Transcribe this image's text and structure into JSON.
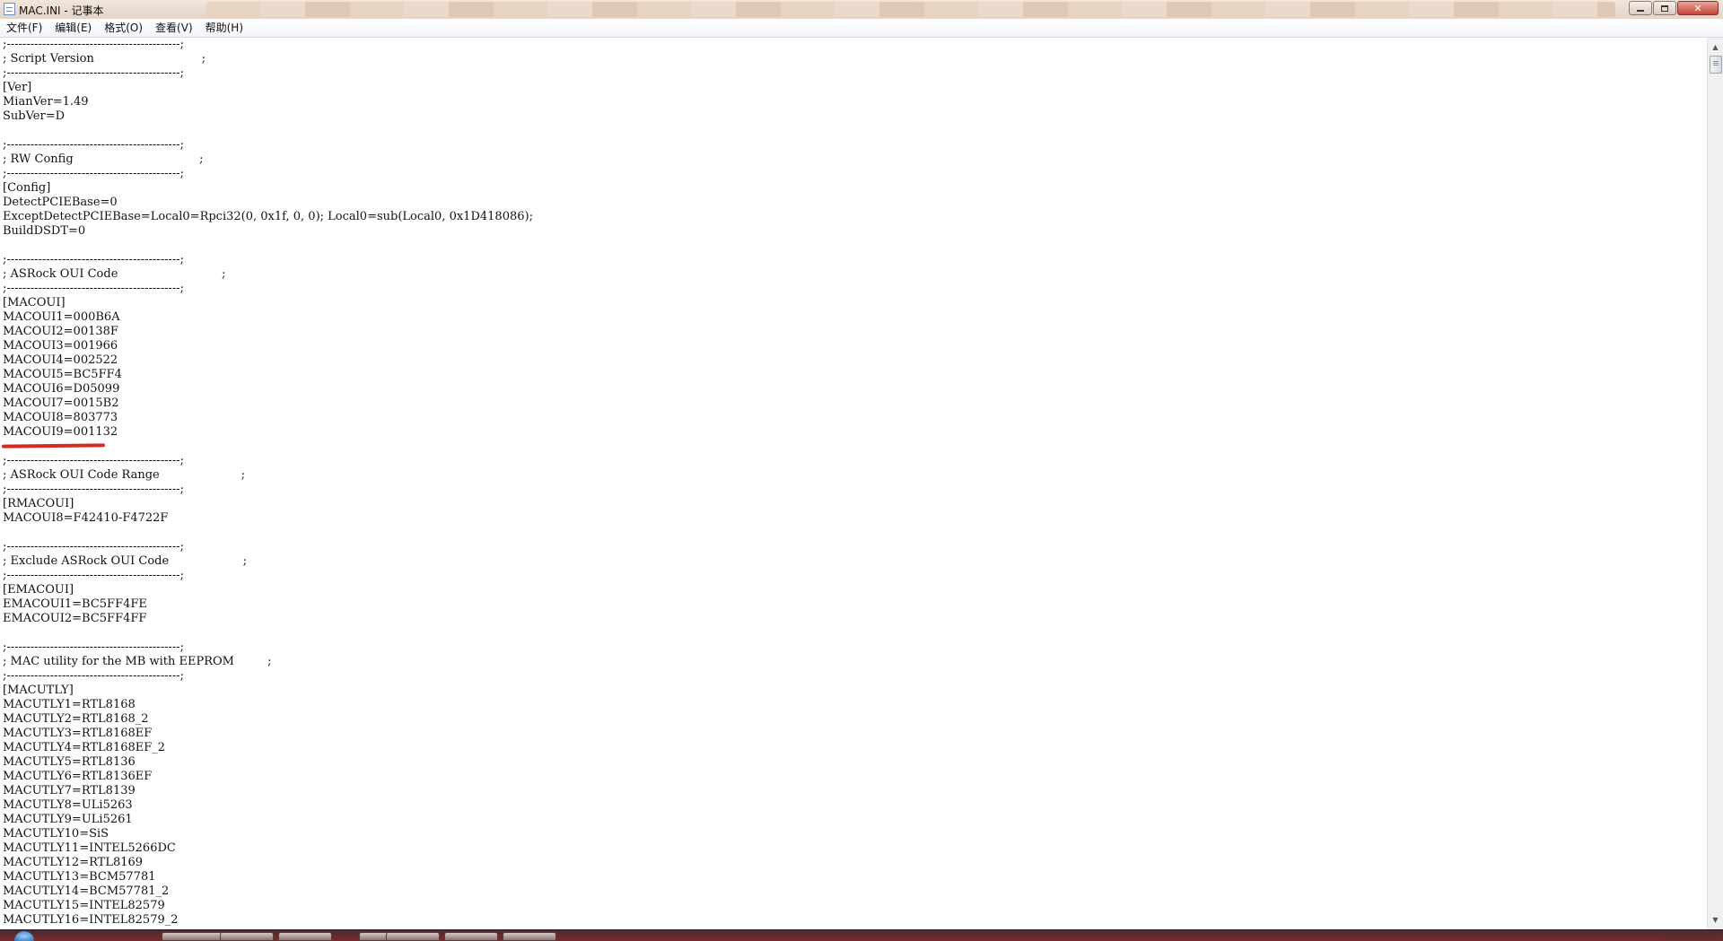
{
  "window": {
    "title": "MAC.INI - 记事本",
    "icon": "notepad-icon",
    "minimize_icon": "minimize-icon",
    "maximize_icon": "maximize-icon",
    "close_glyph": "✕"
  },
  "menu": {
    "items": [
      {
        "label": "文件(F)"
      },
      {
        "label": "编辑(E)"
      },
      {
        "label": "格式(O)"
      },
      {
        "label": "查看(V)"
      },
      {
        "label": "帮助(H)"
      }
    ]
  },
  "editor": {
    "highlight_color": "#d22b20",
    "lines": [
      ";--------------------------------------------;",
      "; Script Version                             ;",
      ";--------------------------------------------;",
      "[Ver]",
      "MianVer=1.49",
      "SubVer=D",
      "",
      ";--------------------------------------------;",
      "; RW Config                                  ;",
      ";--------------------------------------------;",
      "[Config]",
      "DetectPCIEBase=0",
      "ExceptDetectPCIEBase=Local0=Rpci32(0, 0x1f, 0, 0); Local0=sub(Local0, 0x1D418086);",
      "BuildDSDT=0",
      "",
      ";--------------------------------------------;",
      "; ASRock OUI Code                            ;",
      ";--------------------------------------------;",
      "[MACOUI]",
      "MACOUI1=000B6A",
      "MACOUI2=00138F",
      "MACOUI3=001966",
      "MACOUI4=002522",
      "MACOUI5=BC5FF4",
      "MACOUI6=D05099",
      "MACOUI7=0015B2",
      "MACOUI8=803773",
      "MACOUI9=001132",
      "",
      ";--------------------------------------------;",
      "; ASRock OUI Code Range                      ;",
      ";--------------------------------------------;",
      "[RMACOUI]",
      "MACOUI8=F42410-F4722F",
      "",
      ";--------------------------------------------;",
      "; Exclude ASRock OUI Code                    ;",
      ";--------------------------------------------;",
      "[EMACOUI]",
      "EMACOUI1=BC5FF4FE",
      "EMACOUI2=BC5FF4FF",
      "",
      ";--------------------------------------------;",
      "; MAC utility for the MB with EEPROM         ;",
      ";--------------------------------------------;",
      "[MACUTLY]",
      "MACUTLY1=RTL8168",
      "MACUTLY2=RTL8168_2",
      "MACUTLY3=RTL8168EF",
      "MACUTLY4=RTL8168EF_2",
      "MACUTLY5=RTL8136",
      "MACUTLY6=RTL8136EF",
      "MACUTLY7=RTL8139",
      "MACUTLY8=ULi5263",
      "MACUTLY9=ULi5261",
      "MACUTLY10=SiS",
      "MACUTLY11=INTEL5266DC",
      "MACUTLY12=RTL8169",
      "MACUTLY13=BCM57781",
      "MACUTLY14=BCM57781_2",
      "MACUTLY15=INTEL82579",
      "MACUTLY16=INTEL82579_2"
    ]
  },
  "scrollbar": {
    "up_glyph": "▲",
    "down_glyph": "▼"
  }
}
